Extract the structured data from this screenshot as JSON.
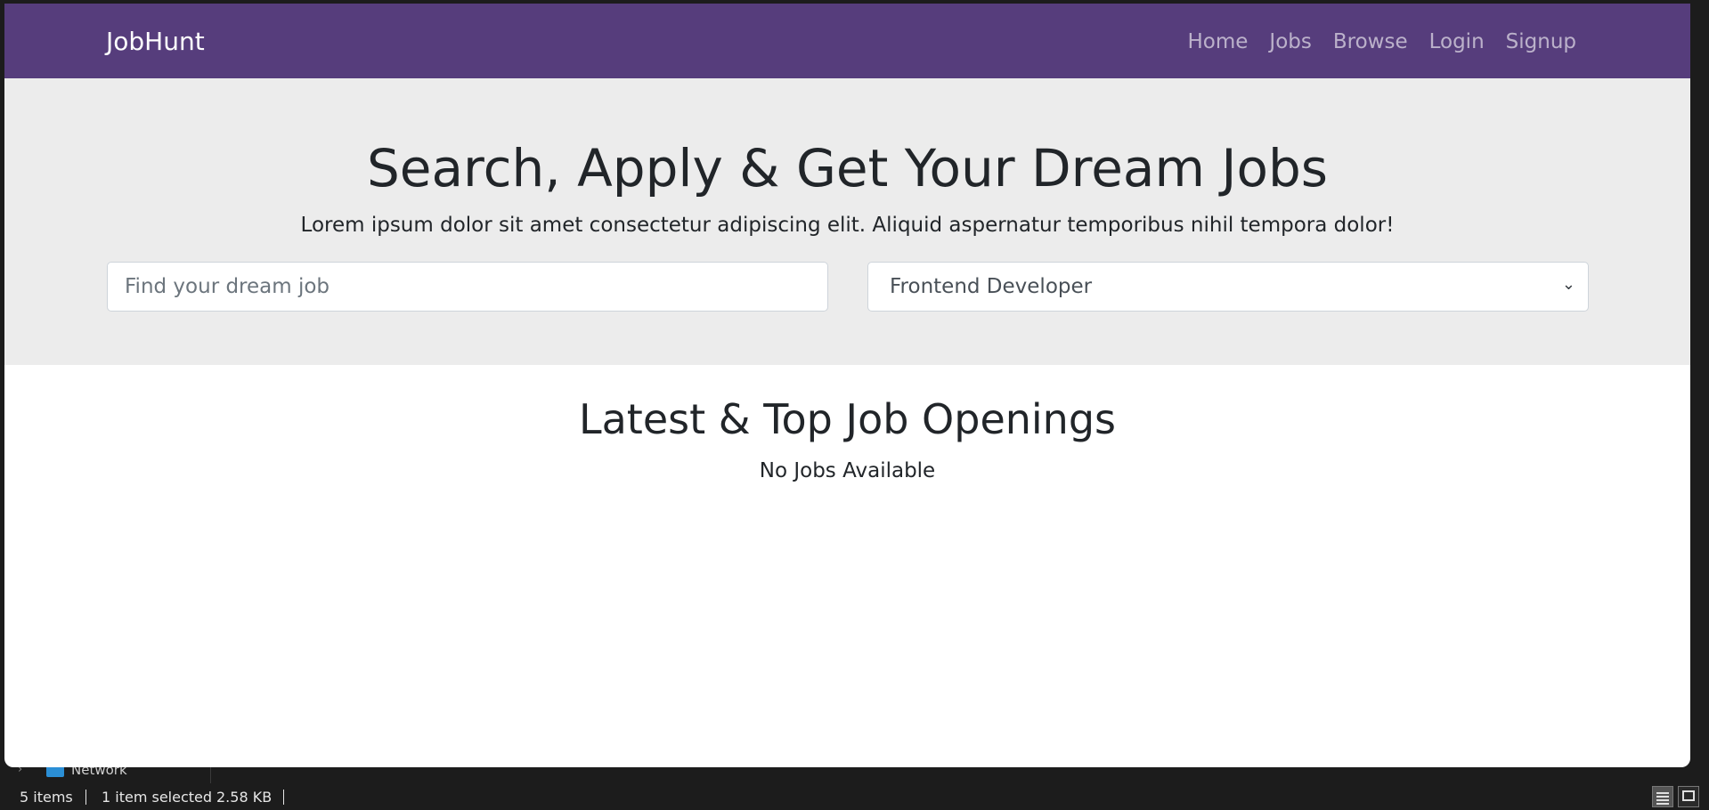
{
  "app": {
    "brand": "JobHunt",
    "nav": [
      "Home",
      "Jobs",
      "Browse",
      "Login",
      "Signup"
    ],
    "accent_color": "#563d7c"
  },
  "hero": {
    "title": "Search, Apply & Get Your Dream Jobs",
    "subtitle": "Lorem ipsum dolor sit amet consectetur adipiscing elit. Aliquid aspernatur temporibus nihil tempora dolor!",
    "search": {
      "placeholder": "Find your dream job",
      "value": ""
    },
    "category_select": {
      "selected": "Frontend Developer",
      "icon": "chevron-down-icon"
    }
  },
  "jobs_section": {
    "title": "Latest & Top Job Openings",
    "empty_message": "No Jobs Available"
  },
  "file_explorer": {
    "tree_item": "Network",
    "status": {
      "item_count": "5 items",
      "selection": "1 item selected",
      "size": "2.58 KB"
    }
  }
}
